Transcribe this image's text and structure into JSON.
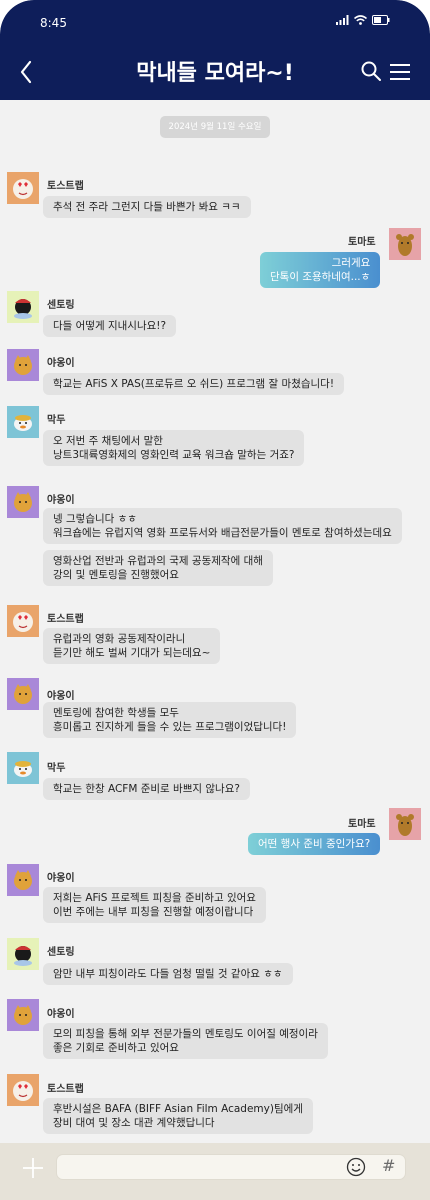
{
  "status": {
    "time": "8:45"
  },
  "header": {
    "title": "막내들 모여라~!"
  },
  "chat": {
    "date": "2024년 9월 11일 수요일",
    "messages": [
      {
        "sender": "토스트랩",
        "lines": [
          "추석 전 주라 그런지 다들 바쁜가 봐요 ㅋㅋ"
        ]
      },
      {
        "sender": "토마토",
        "lines": [
          "그러게요",
          "단톡이 조용하네여...ㅎ"
        ]
      },
      {
        "sender": "센토링",
        "lines": [
          "다들 어떻게 지내시나요!?"
        ]
      },
      {
        "sender": "야옹이",
        "lines": [
          "학교는 AFiS X PAS(프로듀르 오 쉬드) 프로그램 잘 마쳤습니다!"
        ]
      },
      {
        "sender": "막두",
        "lines": [
          "오 저번 주 채팅에서 말한",
          "낭트3대륙영화제의 영화인력 교육 워크숍 말하는 거죠?"
        ]
      },
      {
        "sender": "야옹이",
        "lines": [
          "넹 그렇습니다 ㅎㅎ",
          "워크숍에는 유럽지역 영화 프로듀서와 배급전문가들이 멘토로 참여하셨는데요"
        ]
      },
      {
        "sender": "",
        "lines": [
          "영화산업 전반과 유럽과의 국제 공동제작에 대해",
          "강의 및 멘토링을 진행했어요"
        ]
      },
      {
        "sender": "토스트랩",
        "lines": [
          "유럽과의 영화 공동제작이라니",
          "듣기만 해도 벌써 기대가 되는데요~"
        ]
      },
      {
        "sender": "야옹이",
        "lines": [
          "멘토링에 참여한 학생들 모두",
          "흥미롭고 진지하게 들을 수 있는 프로그램이었답니다!"
        ]
      },
      {
        "sender": "막두",
        "lines": [
          "학교는 한창 ACFM 준비로 바쁘지 않나요?"
        ]
      },
      {
        "sender": "토마토",
        "lines": [
          "어떤 행사 준비 중인가요?"
        ]
      },
      {
        "sender": "야옹이",
        "lines": [
          "저희는 AFiS 프로젝트 피칭을 준비하고 있어요",
          "이번 주에는 내부 피칭을 진행할 예정이랍니다"
        ]
      },
      {
        "sender": "센토링",
        "lines": [
          "암만 내부 피칭이라도 다들 엄청 떨릴 것 같아요 ㅎㅎ"
        ]
      },
      {
        "sender": "야옹이",
        "lines": [
          "모의 피칭을 통해 외부 전문가들의 멘토링도 이어질 예정이라",
          "좋은 기회로 준비하고 있어요"
        ]
      },
      {
        "sender": "토스트랩",
        "lines": [
          "후반시설은 BAFA (BIFF Asian Film Academy)팀에게",
          "장비 대여 및 장소 대관 계약했답니다"
        ]
      }
    ]
  },
  "input": {
    "placeholder": "",
    "value": ""
  },
  "icons": {
    "back": "chevron-left-icon",
    "search": "search-icon",
    "menu": "hamburger-menu-icon",
    "plus": "plus-icon",
    "emoji": "smiley-icon",
    "hash": "#"
  },
  "colors": {
    "header": "#0e1e5a",
    "background": "#f2f2f2",
    "bubble_other": "#e2e2e2",
    "bubble_mine_start": "#7ecfd7",
    "bubble_mine_end": "#4a8fcf",
    "input_bar": "#e6e2d8"
  }
}
